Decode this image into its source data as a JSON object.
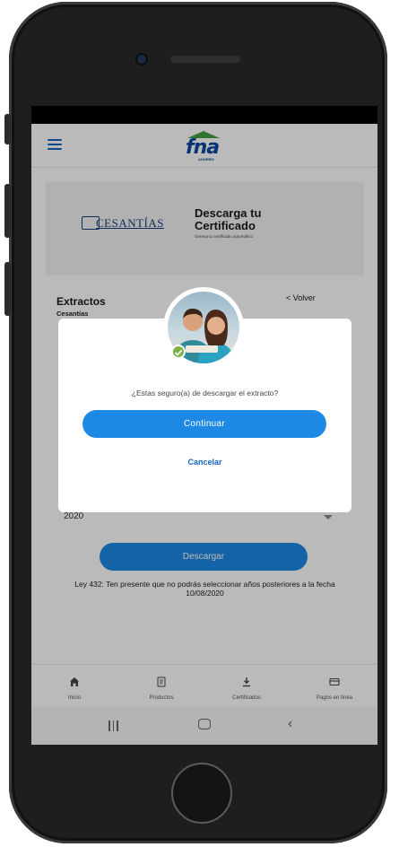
{
  "header": {
    "logo_text": "fna",
    "logo_sub": "AHORRO"
  },
  "banner": {
    "cesantias_logo_text": "CESANTÍAS",
    "title_line1": "Descarga tu",
    "title_line2": "Certificado",
    "subtitle": "Genera tu certificado automático"
  },
  "card": {
    "title": "Extractos",
    "subtitle": "Cesantías",
    "back_label": "< Volver",
    "year_value": "2020",
    "download_label": "Descargar",
    "notice_line1": "Ley 432: Ten presente que no podrás seleccionar años posteriores a la fecha",
    "notice_line2": "10/08/2020"
  },
  "modal": {
    "question": "¿Estas seguro(a) de descargar el extracto?",
    "continue_label": "Continuar",
    "cancel_label": "Cancelar"
  },
  "bottom_nav": {
    "items": [
      {
        "label": "Inicio",
        "icon": "home-icon"
      },
      {
        "label": "Productos",
        "icon": "document-icon"
      },
      {
        "label": "Certificados",
        "icon": "download-icon"
      },
      {
        "label": "Pagos en línea",
        "icon": "credit-card-icon"
      }
    ]
  },
  "colors": {
    "primary": "#1e88e5",
    "brand_blue": "#0d47a1",
    "brand_green": "#43a047",
    "check_green": "#7cb342"
  }
}
